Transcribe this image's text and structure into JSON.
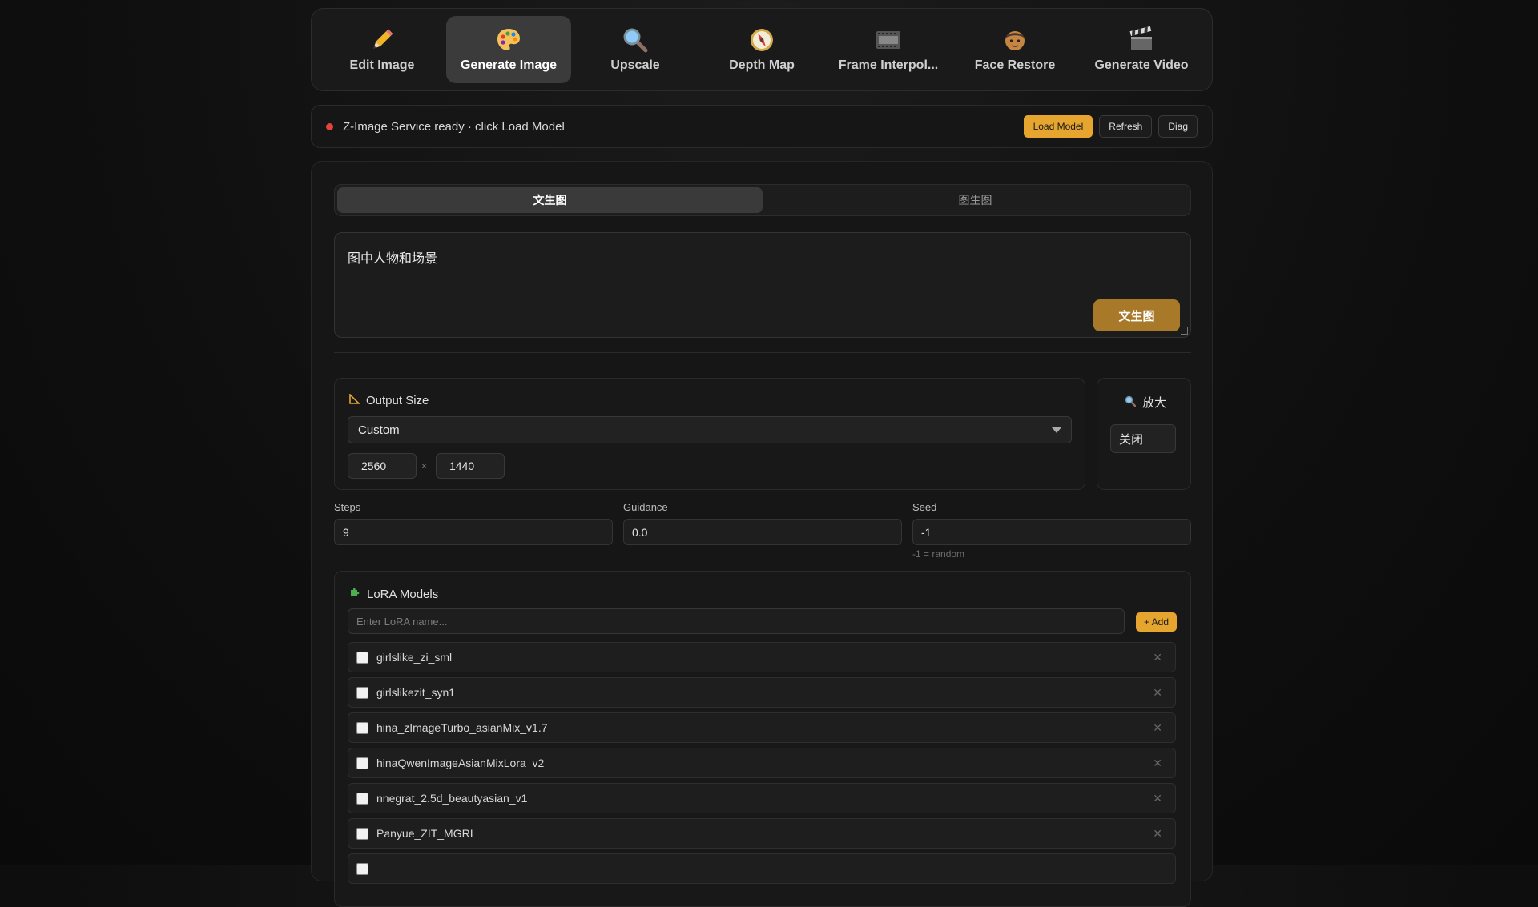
{
  "tabs": [
    {
      "label": "Edit Image",
      "icon": "pencil-icon"
    },
    {
      "label": "Generate Image",
      "icon": "palette-icon",
      "active": true
    },
    {
      "label": "Upscale",
      "icon": "magnifier-icon"
    },
    {
      "label": "Depth Map",
      "icon": "compass-icon"
    },
    {
      "label": "Frame Interpol...",
      "icon": "film-icon"
    },
    {
      "label": "Face Restore",
      "icon": "face-icon"
    },
    {
      "label": "Generate Video",
      "icon": "clapper-icon"
    }
  ],
  "status": {
    "text": "Z-Image Service ready · click Load Model",
    "dot_color": "#e0443a",
    "load_label": "Load Model",
    "refresh_label": "Refresh",
    "diag_label": "Diag"
  },
  "mode_tabs": {
    "txt2img": "文生图",
    "img2img": "图生图",
    "active": "txt2img"
  },
  "prompt": {
    "value": "图中人物和场景",
    "generate_label": "文生图"
  },
  "output_size": {
    "title": "Output Size",
    "preset": "Custom",
    "width": "2560",
    "height": "1440",
    "times": "×"
  },
  "upscale": {
    "title": "放大",
    "value": "关闭"
  },
  "params": {
    "steps": {
      "label": "Steps",
      "value": "9"
    },
    "guidance": {
      "label": "Guidance",
      "value": "0.0"
    },
    "seed": {
      "label": "Seed",
      "value": "-1",
      "hint": "-1 = random"
    }
  },
  "lora": {
    "title": "LoRA Models",
    "placeholder": "Enter LoRA name...",
    "add_label": "+ Add",
    "items": [
      "girlslike_zi_sml",
      "girlslikezit_syn1",
      "hina_zImageTurbo_asianMix_v1.7",
      "hinaQwenImageAsianMixLora_v2",
      "nnegrat_2.5d_beautyasian_v1",
      "Panyue_ZIT_MGRI"
    ]
  },
  "colors": {
    "accent": "#e6a52e",
    "generate_button": "#a9792a"
  }
}
